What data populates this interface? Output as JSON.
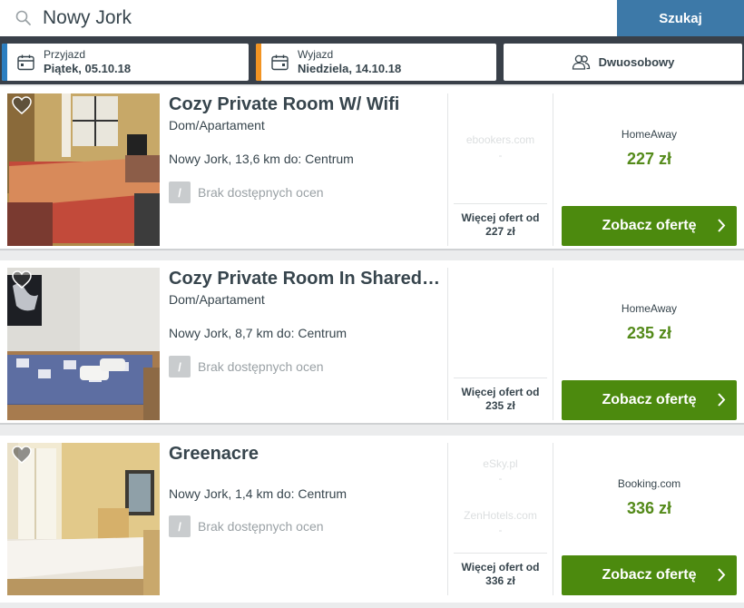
{
  "search": {
    "value": "Nowy Jork",
    "button_label": "Szukaj"
  },
  "dates": {
    "checkin": {
      "label": "Przyjazd",
      "value": "Piątek, 05.10.18",
      "accent": "#2c7fc1"
    },
    "checkout": {
      "label": "Wyjazd",
      "value": "Niedziela, 14.10.18",
      "accent": "#f29423"
    }
  },
  "guests": {
    "label": "Dwuosobowy"
  },
  "results": [
    {
      "title": "Cozy Private Room W/ Wifi",
      "type": "Dom/Apartament",
      "location": "Nowy Jork, 13,6 km do: Centrum",
      "rating_badge": "/",
      "rating_text": "Brak dostępnych ocen",
      "other_sites": [
        "ebookers.com"
      ],
      "other_dash": "-",
      "more_offers_line1": "Więcej ofert od",
      "more_offers_price": "227 zł",
      "provider": "HomeAway",
      "price": "227 zł",
      "button_label": "Zobacz ofertę"
    },
    {
      "title": "Cozy Private Room In Shared Apartment",
      "type": "Dom/Apartament",
      "location": "Nowy Jork, 8,7 km do: Centrum",
      "rating_badge": "/",
      "rating_text": "Brak dostępnych ocen",
      "more_offers_line1": "Więcej ofert od",
      "more_offers_price": "235 zł",
      "provider": "HomeAway",
      "price": "235 zł",
      "button_label": "Zobacz ofertę"
    },
    {
      "title": "Greenacre",
      "location": "Nowy Jork, 1,4 km do: Centrum",
      "rating_badge": "/",
      "rating_text": "Brak dostępnych ocen",
      "other_sites": [
        "eSky.pl",
        "ZenHotels.com"
      ],
      "other_dash": "-",
      "more_offers_line1": "Więcej ofert od",
      "more_offers_price": "336 zł",
      "provider": "Booking.com",
      "price": "336 zł",
      "button_label": "Zobacz ofertę"
    }
  ]
}
